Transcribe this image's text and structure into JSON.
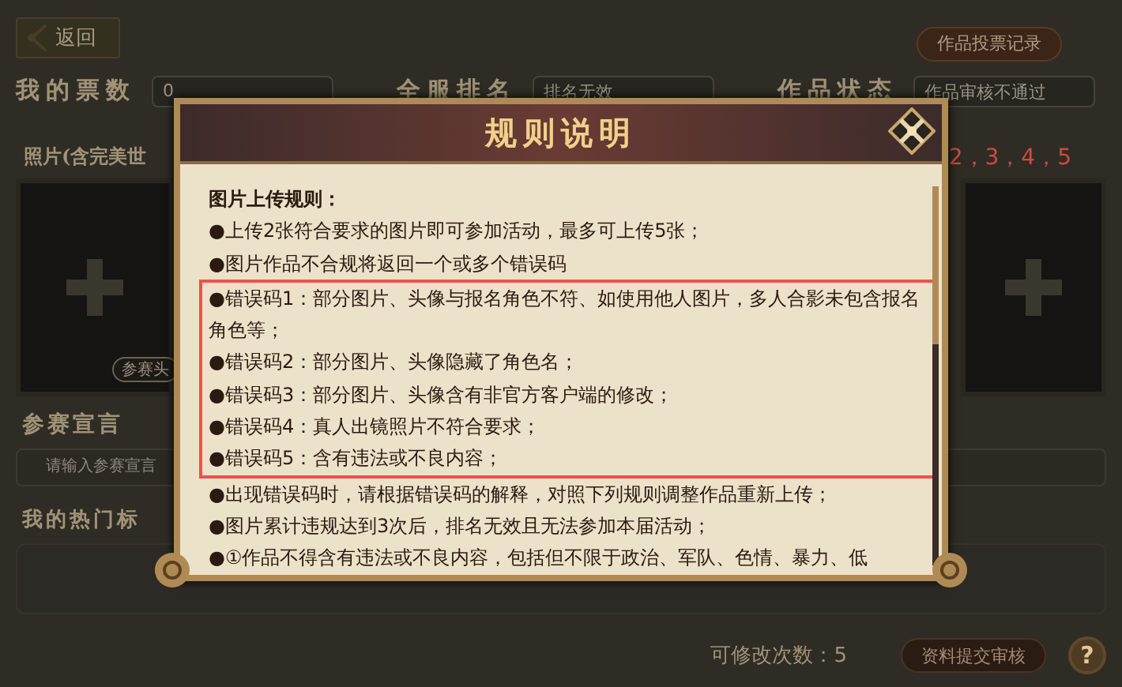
{
  "header": {
    "back_button": "返回",
    "vote_record_button": "作品投票记录"
  },
  "stats": [
    {
      "label": "我的票数",
      "value": "0"
    },
    {
      "label": "全服排名",
      "value": "排名无效"
    },
    {
      "label": "作品状态",
      "value": "作品审核不通过"
    }
  ],
  "photos": {
    "label": "照片(含完美世",
    "slot_numbers": "2，3，4，5",
    "avatar_tag": "参赛头"
  },
  "declaration": {
    "label": "参赛宣言",
    "placeholder": "请输入参赛宣言"
  },
  "tags": {
    "label": "我的热门标"
  },
  "footer": {
    "edits_left": "可修改次数：5",
    "submit_button": "资料提交审核",
    "help_button": "?"
  },
  "modal": {
    "title": "规则说明",
    "heading": "图片上传规则：",
    "rules_before": [
      "●上传2张符合要求的图片即可参加活动，最多可上传5张；",
      "●图片作品不合规将返回一个或多个错误码"
    ],
    "highlighted_rules": [
      "●错误码1：部分图片、头像与报名角色不符、如使用他人图片，多人合影未包含报名角色等；",
      "●错误码2：部分图片、头像隐藏了角色名；",
      "●错误码3：部分图片、头像含有非官方客户端的修改；",
      "●错误码4：真人出镜照片不符合要求；",
      "●错误码5：含有违法或不良内容；"
    ],
    "rules_after": [
      "●出现错误码时，请根据错误码的解释，对照下列规则调整作品重新上传；",
      "●图片累计违规达到3次后，排名无效且无法参加本届活动；",
      "●①作品不得含有违法或不良内容，包括但不限于政治、军队、色情、暴力、低"
    ]
  }
}
